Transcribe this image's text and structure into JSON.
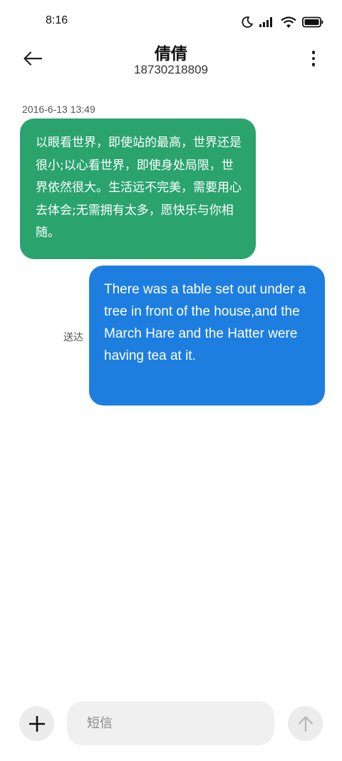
{
  "status_bar": {
    "time": "8:16"
  },
  "header": {
    "contact_name": "倩倩",
    "contact_number": "18730218809"
  },
  "conversation": {
    "timestamp": "2016-6-13 13:49",
    "messages": [
      {
        "direction": "received",
        "text": "以眼看世界，即使站的最高，世界还是很小;以心看世界，即使身处局限，世界依然很大。生活远不完美，需要用心去体会;无需拥有太多，愿快乐与你相随。"
      },
      {
        "direction": "sent",
        "text": "There was a table set out under a tree in front of the house,and the March Hare and the Hatter were having tea at it.",
        "status": "送达"
      }
    ]
  },
  "composer": {
    "placeholder": "短信"
  },
  "colors": {
    "received_bubble": "#2aa36d",
    "sent_bubble": "#1d7ee0"
  }
}
